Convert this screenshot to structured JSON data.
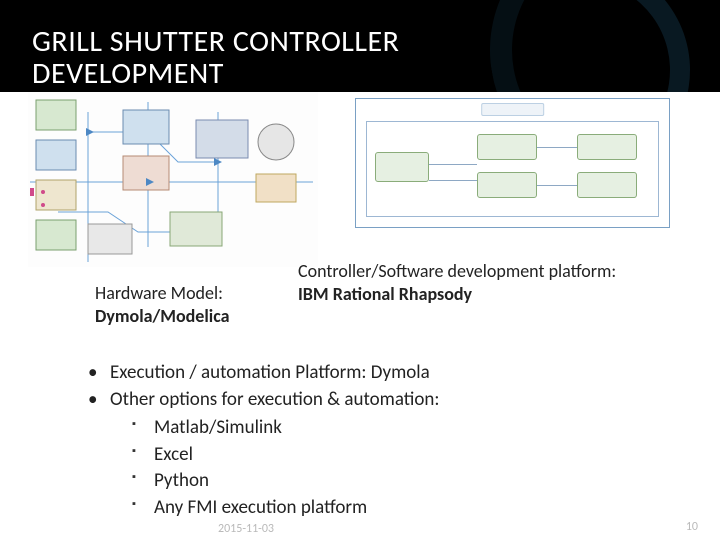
{
  "title": "GRILL SHUTTER CONTROLLER\nDEVELOPMENT",
  "hw_caption_prefix": "Hardware Model:",
  "hw_caption_bold": "Dymola/Modelica",
  "sw_caption_prefix": "Controller/Software development platform:",
  "sw_caption_bold": "IBM Rational Rhapsody",
  "bullets": {
    "b1": "Execution / automation Platform: Dymola",
    "b2": "Other options for execution & automation:",
    "sub": {
      "s1": "Matlab/Simulink",
      "s2": "Excel",
      "s3": "Python",
      "s4": "Any FMI execution platform"
    }
  },
  "footer_date": "2015-11-03",
  "footer_page": "10"
}
